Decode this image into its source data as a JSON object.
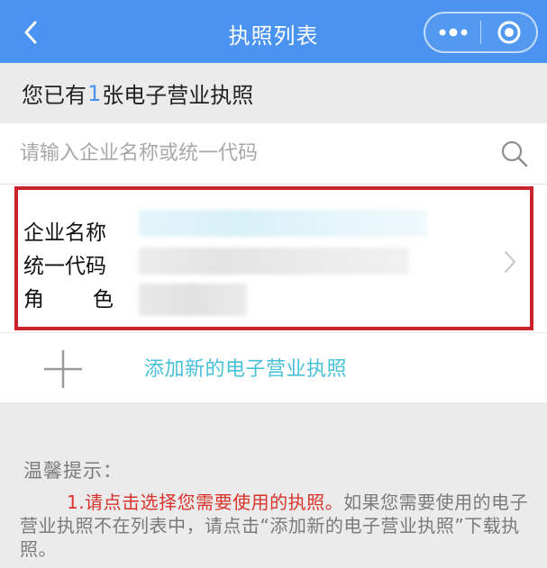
{
  "header": {
    "title": "执照列表",
    "back_icon": "chevron-left-icon",
    "more_icon": "more-dots-icon",
    "close_icon": "target-circle-icon",
    "bg_color": "#4a93f0"
  },
  "banner": {
    "prefix": "您已有",
    "count": "1",
    "suffix": "张电子营业执照"
  },
  "search": {
    "placeholder": "请输入企业名称或统一代码",
    "value": "",
    "icon": "search-icon"
  },
  "license": {
    "name_label": "企业名称",
    "code_label": "统一代码",
    "role_label_1": "角",
    "role_label_2": "色",
    "highlight_color": "#c8242a"
  },
  "add": {
    "label": "添加新的电子营业执照",
    "icon": "plus-icon",
    "color": "#47c1d7"
  },
  "tips": {
    "title": "温馨提示：",
    "highlight": "1.请点击选择您需要使用的执照。",
    "rest": "如果您需要使用的电子营业执照不在列表中，请点击“添加新的电子营业执照”下载执照。",
    "highlight_color": "#d9332b"
  }
}
